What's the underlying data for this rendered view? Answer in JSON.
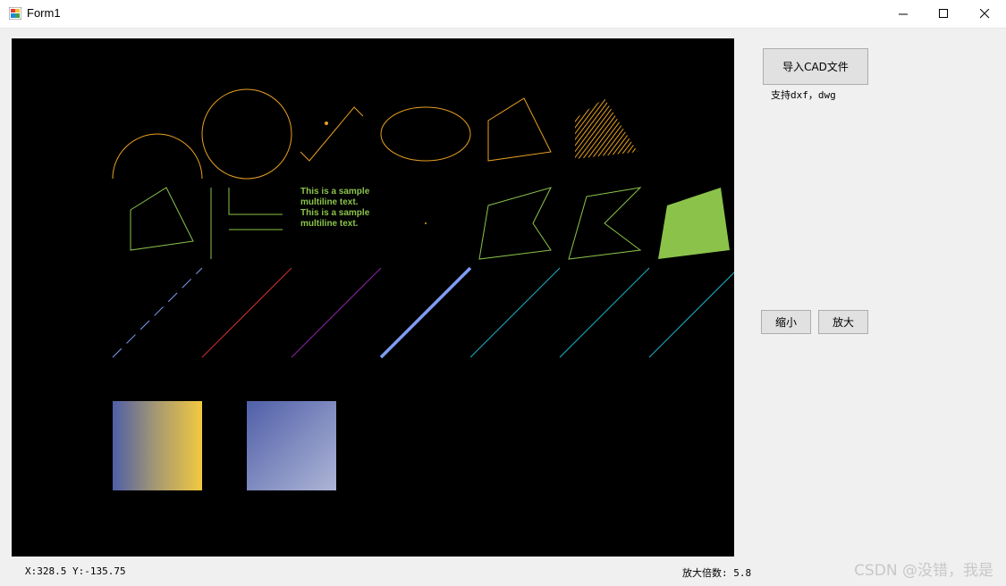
{
  "window": {
    "title": "Form1"
  },
  "controls": {
    "import_button": "导入CAD文件",
    "supported_formats": "支持dxf，dwg",
    "zoom_out_button": "缩小",
    "zoom_in_button": "放大"
  },
  "status": {
    "coordinates": "X:328.5 Y:-135.75",
    "zoom_label": "放大倍数: 5.8"
  },
  "canvas": {
    "sample_text_lines": [
      "This is a sample",
      "multiline text.",
      "This is a sample",
      "multiline text."
    ]
  },
  "watermark": "CSDN @没错，我是",
  "colors": {
    "orange": "#e8a020",
    "green": "#8bc34a",
    "cyan": "#1bb3c9",
    "blue": "#7f9cf5"
  }
}
